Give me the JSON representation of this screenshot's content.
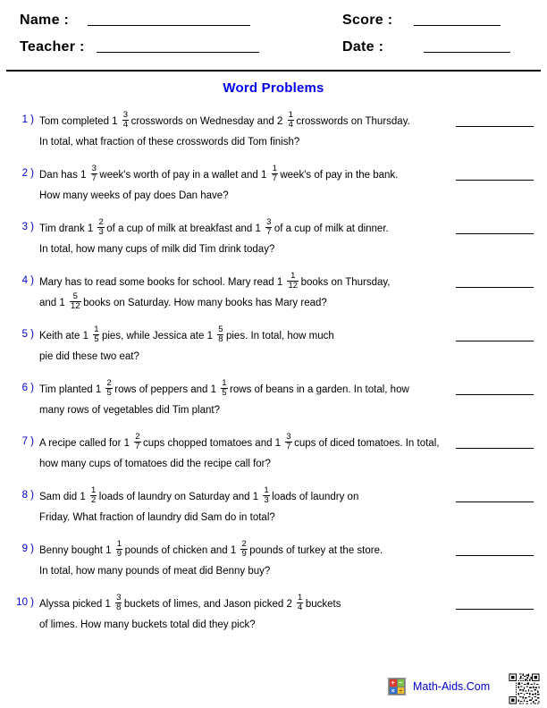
{
  "header": {
    "name_label": "Name :",
    "teacher_label": "Teacher :",
    "score_label": "Score :",
    "date_label": "Date :"
  },
  "title": "Word Problems",
  "problems": [
    {
      "number": "1 )",
      "lines": [
        [
          {
            "t": "text",
            "v": "Tom completed 1"
          },
          {
            "t": "frac",
            "n": "3",
            "d": "4"
          },
          {
            "t": "text",
            "v": "crosswords on Wednesday and 2"
          },
          {
            "t": "frac",
            "n": "1",
            "d": "4"
          },
          {
            "t": "text",
            "v": "crosswords on Thursday."
          }
        ],
        [
          {
            "t": "text",
            "v": "In total, what fraction of these crosswords did Tom finish?"
          }
        ]
      ]
    },
    {
      "number": "2 )",
      "lines": [
        [
          {
            "t": "text",
            "v": "Dan has 1"
          },
          {
            "t": "frac",
            "n": "3",
            "d": "7"
          },
          {
            "t": "text",
            "v": "week's worth of pay in a wallet and 1"
          },
          {
            "t": "frac",
            "n": "1",
            "d": "7"
          },
          {
            "t": "text",
            "v": "week's of pay in the bank."
          }
        ],
        [
          {
            "t": "text",
            "v": "How many weeks of pay does Dan have?"
          }
        ]
      ]
    },
    {
      "number": "3 )",
      "lines": [
        [
          {
            "t": "text",
            "v": "Tim drank 1"
          },
          {
            "t": "frac",
            "n": "2",
            "d": "3"
          },
          {
            "t": "text",
            "v": "of a cup of milk at breakfast and 1"
          },
          {
            "t": "frac",
            "n": "3",
            "d": "7"
          },
          {
            "t": "text",
            "v": "of a cup of milk at dinner."
          }
        ],
        [
          {
            "t": "text",
            "v": "In total, how many cups of milk did Tim drink today?"
          }
        ]
      ]
    },
    {
      "number": "4 )",
      "lines": [
        [
          {
            "t": "text",
            "v": "Mary has to read some books for school. Mary read 1"
          },
          {
            "t": "frac",
            "n": "1",
            "d": "12"
          },
          {
            "t": "text",
            "v": "books on Thursday,"
          }
        ],
        [
          {
            "t": "text",
            "v": "and 1"
          },
          {
            "t": "frac",
            "n": "5",
            "d": "12"
          },
          {
            "t": "text",
            "v": "books on Saturday. How many books has Mary read?"
          }
        ]
      ]
    },
    {
      "number": "5 )",
      "lines": [
        [
          {
            "t": "text",
            "v": "Keith ate 1"
          },
          {
            "t": "frac",
            "n": "1",
            "d": "5"
          },
          {
            "t": "text",
            "v": "pies, while Jessica ate 1"
          },
          {
            "t": "frac",
            "n": "5",
            "d": "8"
          },
          {
            "t": "text",
            "v": "pies. In total, how much"
          }
        ],
        [
          {
            "t": "text",
            "v": "pie did these two eat?"
          }
        ]
      ]
    },
    {
      "number": "6 )",
      "lines": [
        [
          {
            "t": "text",
            "v": "Tim planted 1"
          },
          {
            "t": "frac",
            "n": "2",
            "d": "5"
          },
          {
            "t": "text",
            "v": "rows of peppers and 1"
          },
          {
            "t": "frac",
            "n": "1",
            "d": "5"
          },
          {
            "t": "text",
            "v": "rows of beans in a garden. In total, how"
          }
        ],
        [
          {
            "t": "text",
            "v": "many rows of vegetables did Tim plant?"
          }
        ]
      ]
    },
    {
      "number": "7 )",
      "lines": [
        [
          {
            "t": "text",
            "v": "A recipe called for 1"
          },
          {
            "t": "frac",
            "n": "2",
            "d": "7"
          },
          {
            "t": "text",
            "v": "cups chopped tomatoes and 1"
          },
          {
            "t": "frac",
            "n": "3",
            "d": "7"
          },
          {
            "t": "text",
            "v": "cups of diced tomatoes. In total,"
          }
        ],
        [
          {
            "t": "text",
            "v": "how many cups of tomatoes did the recipe call for?"
          }
        ]
      ]
    },
    {
      "number": "8 )",
      "lines": [
        [
          {
            "t": "text",
            "v": "Sam did 1"
          },
          {
            "t": "frac",
            "n": "1",
            "d": "2"
          },
          {
            "t": "text",
            "v": "loads of laundry on Saturday and 1"
          },
          {
            "t": "frac",
            "n": "1",
            "d": "3"
          },
          {
            "t": "text",
            "v": "loads of laundry on"
          }
        ],
        [
          {
            "t": "text",
            "v": "Friday. What fraction of laundry did Sam do in total?"
          }
        ]
      ]
    },
    {
      "number": "9 )",
      "lines": [
        [
          {
            "t": "text",
            "v": "Benny bought 1"
          },
          {
            "t": "frac",
            "n": "1",
            "d": "9"
          },
          {
            "t": "text",
            "v": "pounds of chicken and 1"
          },
          {
            "t": "frac",
            "n": "2",
            "d": "9"
          },
          {
            "t": "text",
            "v": "pounds of turkey at the store."
          }
        ],
        [
          {
            "t": "text",
            "v": "In total, how many pounds of meat did Benny buy?"
          }
        ]
      ]
    },
    {
      "number": "10 )",
      "lines": [
        [
          {
            "t": "text",
            "v": "Alyssa picked 1"
          },
          {
            "t": "frac",
            "n": "3",
            "d": "8"
          },
          {
            "t": "text",
            "v": "buckets of limes, and Jason picked 2"
          },
          {
            "t": "frac",
            "n": "1",
            "d": "4"
          },
          {
            "t": "text",
            "v": "buckets"
          }
        ],
        [
          {
            "t": "text",
            "v": "of limes. How many buckets total did they pick?"
          }
        ]
      ]
    }
  ],
  "footer": {
    "brand_name": "Math-Aids.Com",
    "icon_ops": [
      "+",
      "−",
      "×",
      "÷"
    ]
  },
  "colors": {
    "title_blue": "#0000ee",
    "number_blue": "#0000cc",
    "brand_blue": "#0000cc",
    "rule_black": "#000000"
  }
}
